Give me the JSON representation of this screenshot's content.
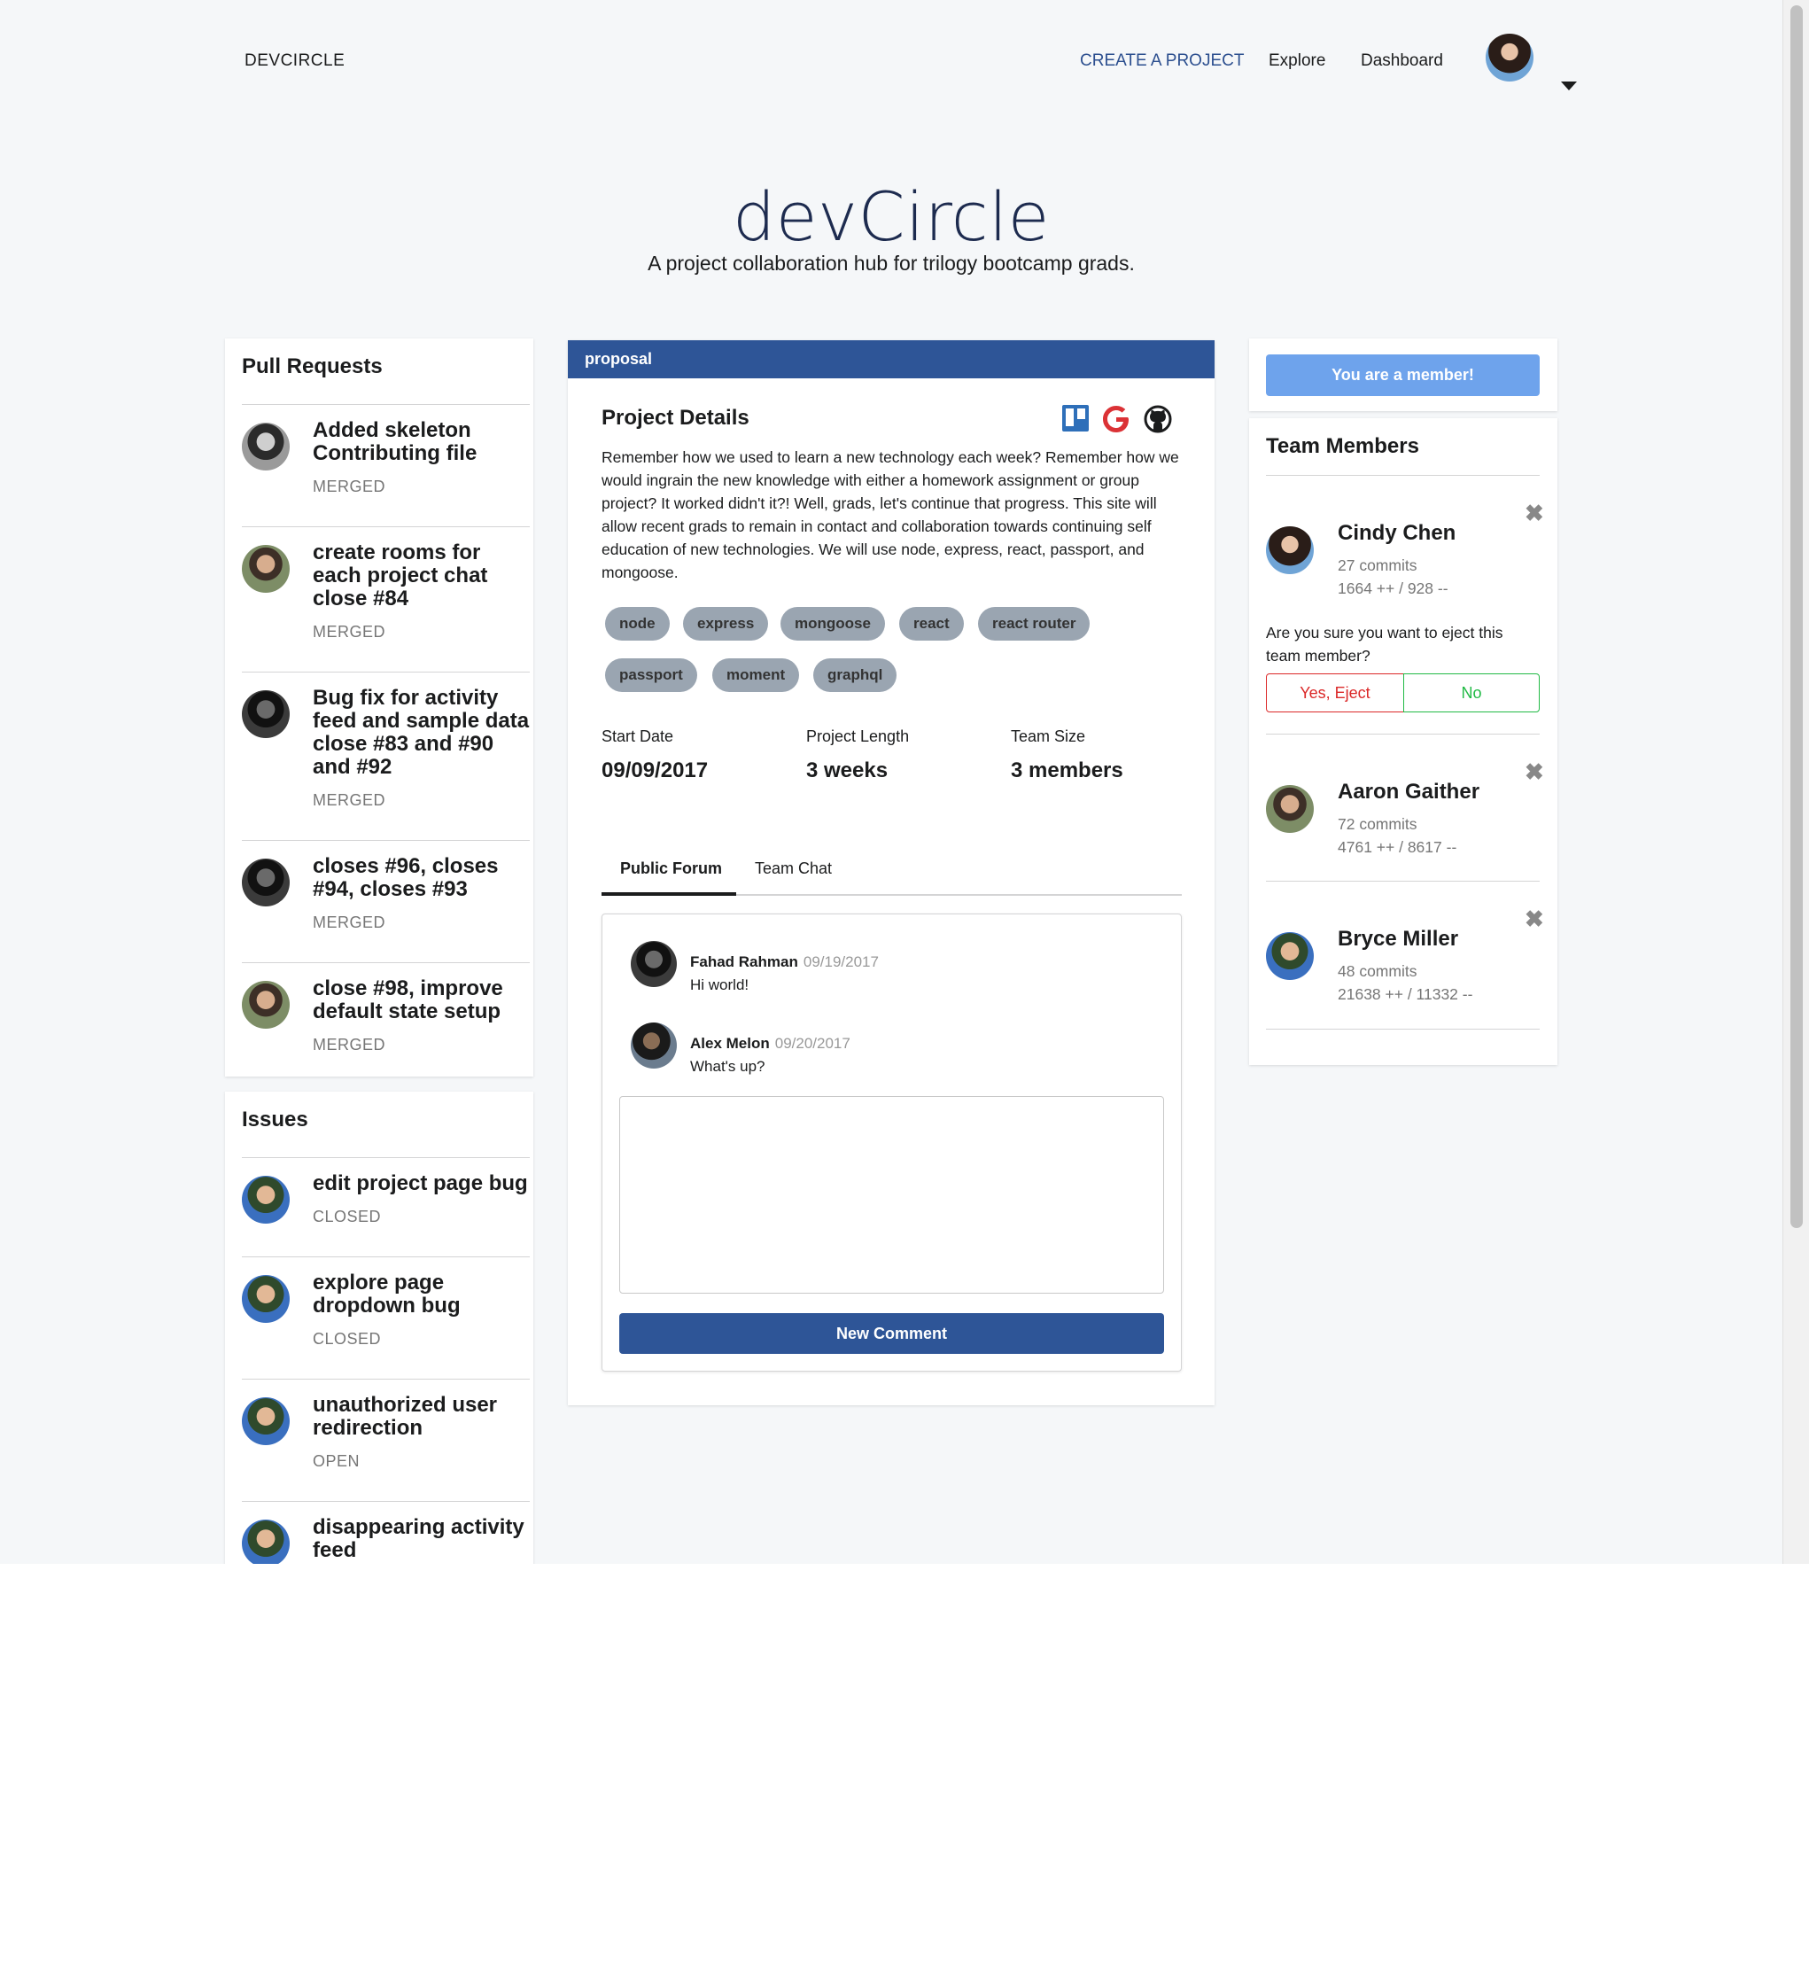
{
  "nav": {
    "logo": "DEVCIRCLE",
    "create_project": "CREATE A PROJECT",
    "explore": "Explore",
    "dashboard": "Dashboard"
  },
  "hero": {
    "title": "devCircle",
    "subtitle": "A project collaboration hub for trilogy bootcamp grads."
  },
  "pull_requests": {
    "heading": "Pull Requests",
    "items": [
      {
        "title": "Added skeleton Contributing file",
        "status": "MERGED"
      },
      {
        "title": "create rooms for each project chat close #84",
        "status": "MERGED"
      },
      {
        "title": "Bug fix for activity feed and sample data close #83 and #90 and #92",
        "status": "MERGED"
      },
      {
        "title": "closes #96, closes #94, closes #93",
        "status": "MERGED"
      },
      {
        "title": "close #98, improve default state setup",
        "status": "MERGED"
      }
    ]
  },
  "issues": {
    "heading": "Issues",
    "items": [
      {
        "title": "edit project page bug",
        "status": "CLOSED"
      },
      {
        "title": "explore page dropdown bug",
        "status": "CLOSED"
      },
      {
        "title": "unauthorized user redirection",
        "status": "OPEN"
      },
      {
        "title": "disappearing activity feed",
        "status": ""
      }
    ]
  },
  "project": {
    "status_bar": "proposal",
    "details_title": "Project Details",
    "description": "Remember how we used to learn a new technology each week? Remember how we would ingrain the new knowledge with either a homework assignment or group project? It worked didn't it?! Well, grads, let's continue that progress. This site will allow recent grads to remain in contact and collaboration towards continuing self education of new technologies. We will use node, express, react, passport, and mongoose.",
    "tags": [
      "node",
      "express",
      "mongoose",
      "react",
      "react router",
      "passport",
      "moment",
      "graphql"
    ],
    "stats": {
      "start_date_label": "Start Date",
      "start_date": "09/09/2017",
      "length_label": "Project Length",
      "length": "3 weeks",
      "team_size_label": "Team Size",
      "team_size": "3 members"
    },
    "tabs": [
      "Public Forum",
      "Team Chat"
    ],
    "comments": [
      {
        "author": "Fahad Rahman",
        "date": "09/19/2017",
        "text": "Hi world!"
      },
      {
        "author": "Alex Melon",
        "date": "09/20/2017",
        "text": "What's up?"
      }
    ],
    "new_comment_label": "New Comment",
    "icons": [
      "trello-icon",
      "google-icon",
      "github-icon"
    ],
    "colors": {
      "primary": "#2e5597",
      "tag": "#9aa5b1",
      "google": "#db3236"
    }
  },
  "team": {
    "member_button": "You are a member!",
    "heading": "Team Members",
    "members": [
      {
        "name": "Cindy Chen",
        "commits": "27 commits",
        "lines": "1664 ++ / 928 --"
      },
      {
        "name": "Aaron Gaither",
        "commits": "72 commits",
        "lines": "4761 ++ / 8617 --"
      },
      {
        "name": "Bryce Miller",
        "commits": "48 commits",
        "lines": "21638 ++ / 11332 --"
      }
    ],
    "eject_question": "Are you sure you want to eject this team member?",
    "eject_yes": "Yes, Eject",
    "eject_no": "No"
  }
}
